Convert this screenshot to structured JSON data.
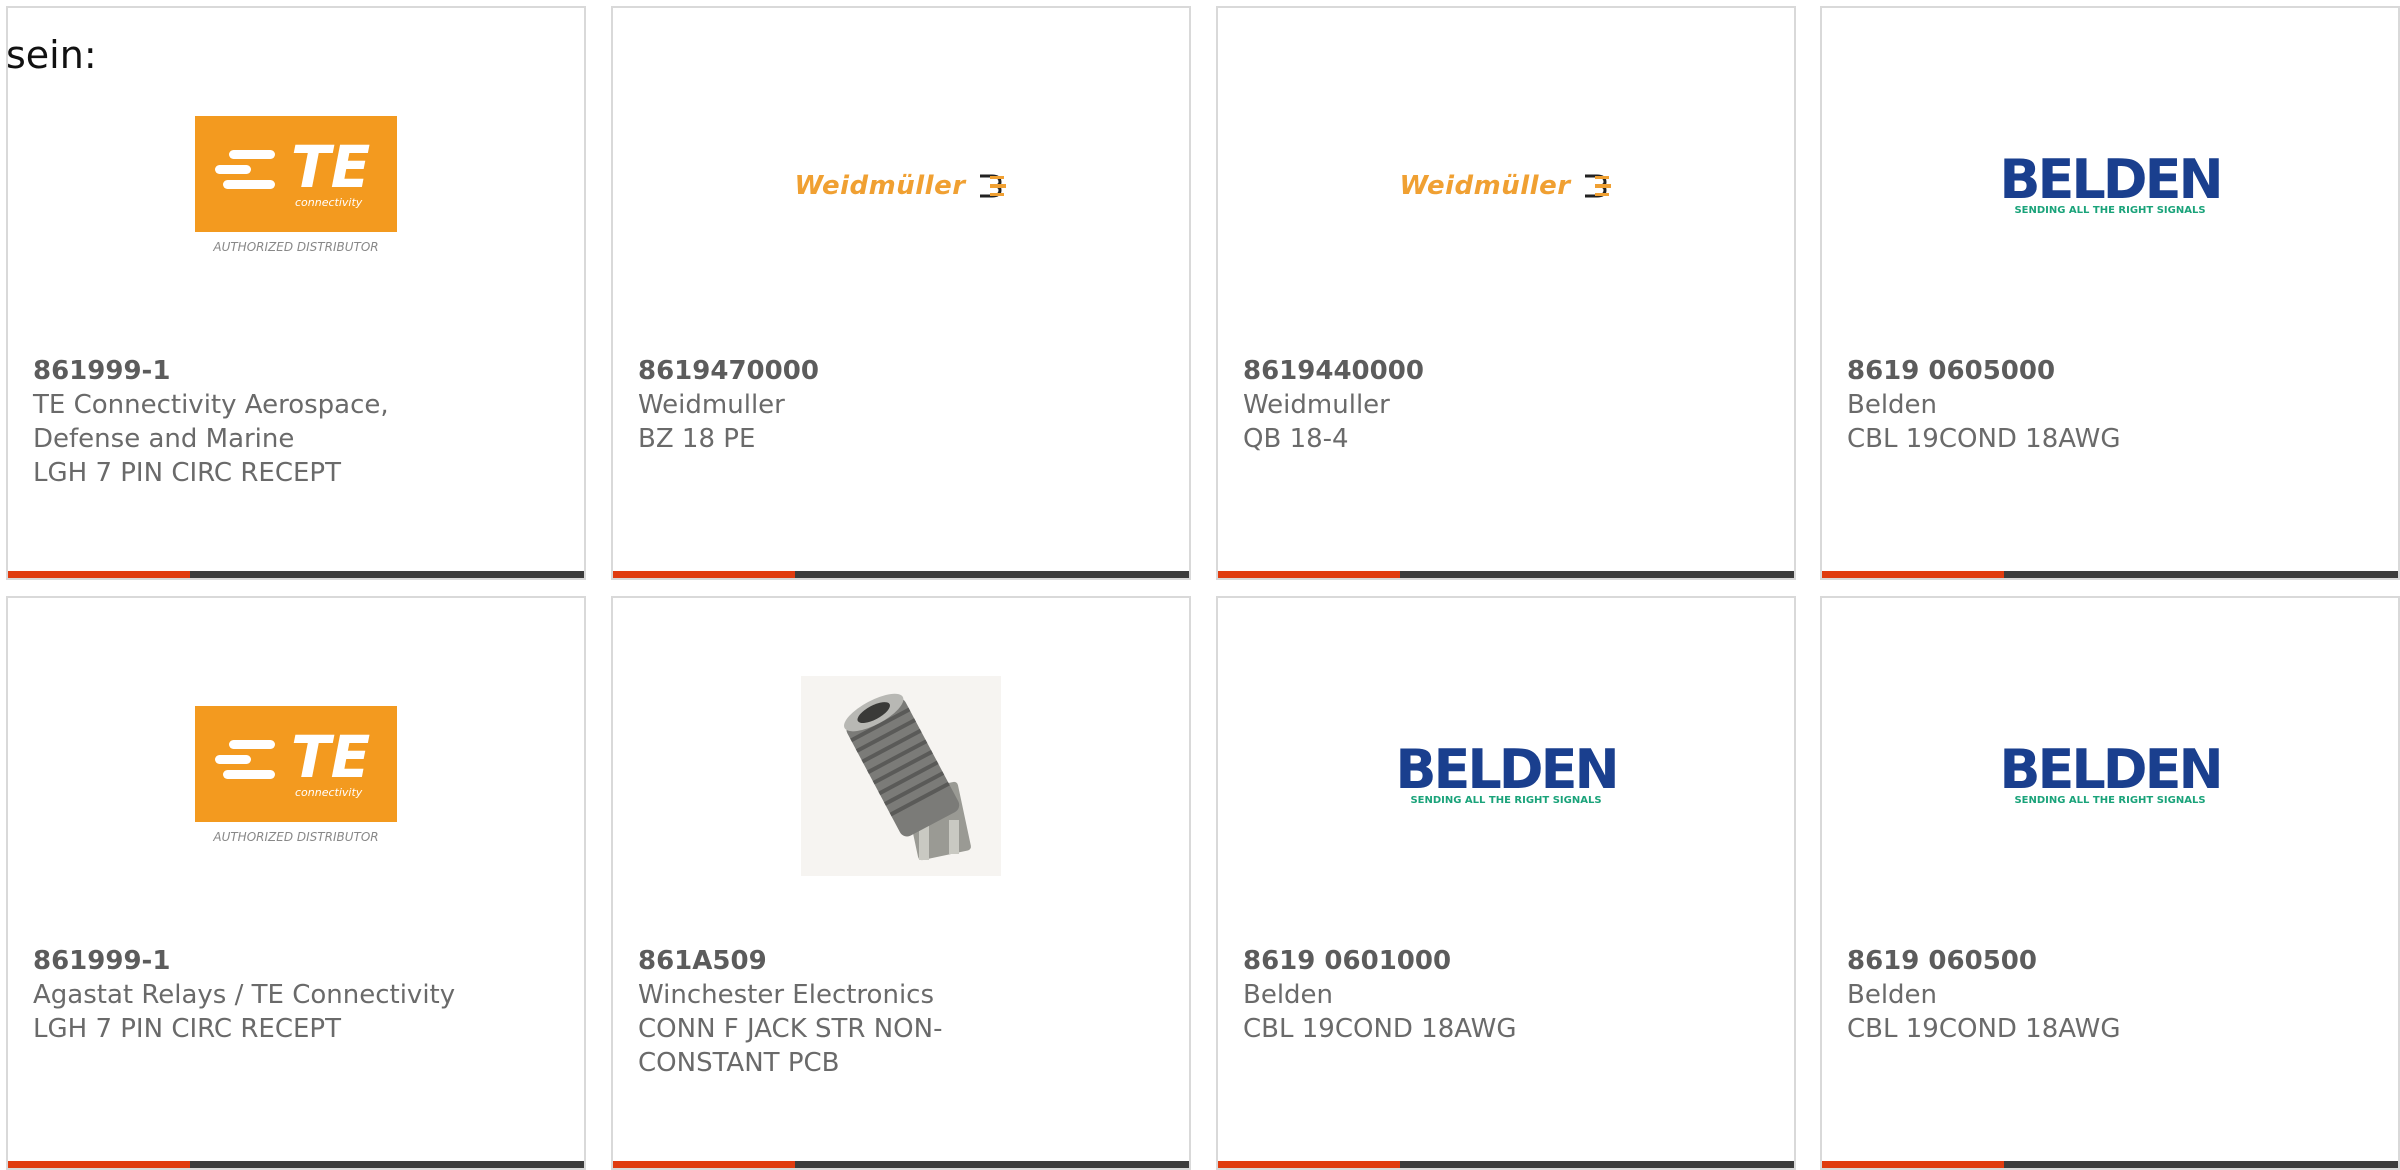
{
  "page": {
    "lead_text": "sein:"
  },
  "colors": {
    "accent": "#e03c10",
    "bar": "#3c3c3c",
    "te_orange": "#f39a1f",
    "weidmuller_orange": "#f0a032",
    "belden_blue": "#1a3f8e",
    "belden_green": "#1aa37a"
  },
  "logos": {
    "te": {
      "word": "TE",
      "sub": "connectivity",
      "auth": "AUTHORIZED DISTRIBUTOR"
    },
    "weidmuller": {
      "word": "Weidmüller"
    },
    "belden": {
      "word": "BELDEN",
      "tag": "SENDING ALL THE RIGHT SIGNALS"
    }
  },
  "products": [
    {
      "part": "861999-1",
      "manufacturer": "TE Connectivity Aerospace, Defense and Marine",
      "description": "LGH 7 PIN CIRC RECEPT",
      "image": "te-logo"
    },
    {
      "part": "8619470000",
      "manufacturer": "Weidmuller",
      "description": "BZ 18 PE",
      "image": "weidmuller-logo"
    },
    {
      "part": "8619440000",
      "manufacturer": "Weidmuller",
      "description": "QB 18-4",
      "image": "weidmuller-logo"
    },
    {
      "part": "8619 0605000",
      "manufacturer": "Belden",
      "description": "CBL 19COND 18AWG",
      "image": "belden-logo"
    },
    {
      "part": "861999-1",
      "manufacturer": "Agastat Relays / TE Connectivity",
      "description": "LGH 7 PIN CIRC RECEPT",
      "image": "te-logo"
    },
    {
      "part": "861A509",
      "manufacturer": "Winchester Electronics",
      "description": "CONN F JACK STR NON-CONSTANT PCB",
      "image": "connector-photo"
    },
    {
      "part": "8619 0601000",
      "manufacturer": "Belden",
      "description": "CBL 19COND 18AWG",
      "image": "belden-logo"
    },
    {
      "part": "8619 060500",
      "manufacturer": "Belden",
      "description": "CBL 19COND 18AWG",
      "image": "belden-logo"
    }
  ]
}
